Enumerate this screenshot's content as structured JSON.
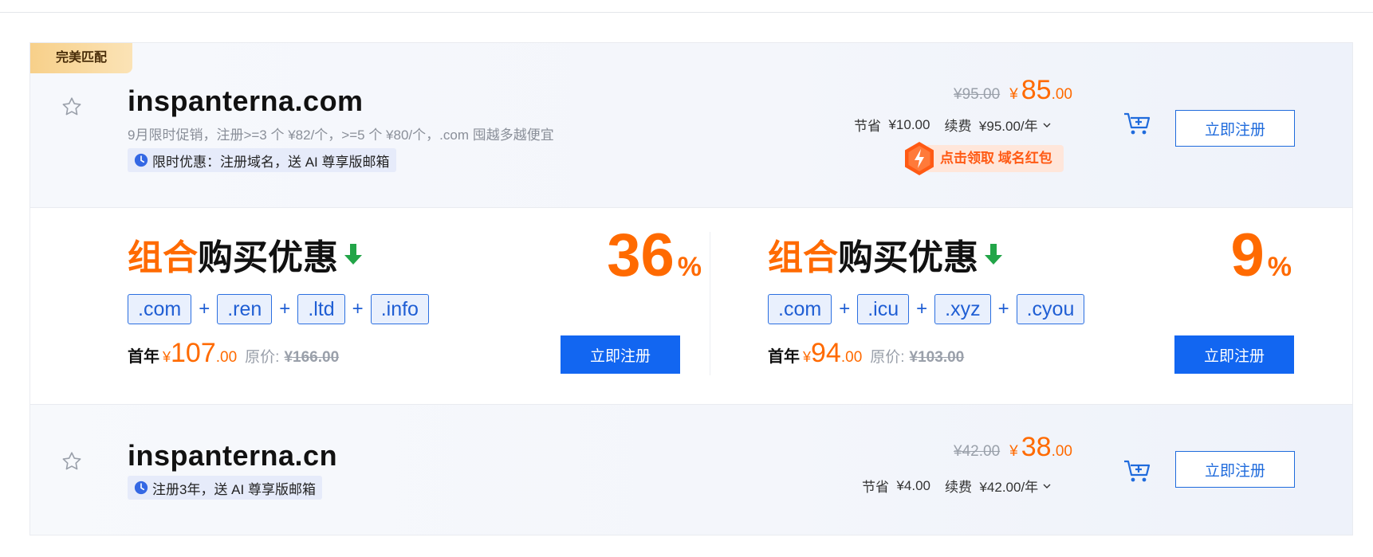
{
  "badge": "完美匹配",
  "results": [
    {
      "domain": "inspanterna.com",
      "promo": "9月限时促销，注册>=3 个 ¥82/个，>=5 个 ¥80/个，.com 囤越多越便宜",
      "tag": "限时优惠：注册域名，送 AI 尊享版邮箱",
      "old_price": "¥95.00",
      "currency": "¥",
      "price_int": "85",
      "price_dec": ".00",
      "save_label": "节省",
      "save_value": "¥10.00",
      "renew_label": "续费",
      "renew_value": "¥95.00/年",
      "coupon": "点击领取 域名红包",
      "register": "立即注册"
    },
    {
      "domain": "inspanterna.cn",
      "tag": "注册3年，送 AI 尊享版邮箱",
      "old_price": "¥42.00",
      "currency": "¥",
      "price_int": "38",
      "price_dec": ".00",
      "save_label": "节省",
      "save_value": "¥4.00",
      "renew_label": "续费",
      "renew_value": "¥42.00/年",
      "register": "立即注册"
    }
  ],
  "combos": [
    {
      "title_orange": "组合",
      "title_black": "购买优惠",
      "discount": "36",
      "pct": "%",
      "suffixes": [
        ".com",
        ".ren",
        ".ltd",
        ".info"
      ],
      "plus": "+",
      "first_year_label": "首年",
      "currency": "¥",
      "price_int": "107",
      "price_dec": ".00",
      "orig_label": "原价:",
      "orig_price": "¥166.00",
      "register": "立即注册"
    },
    {
      "title_orange": "组合",
      "title_black": "购买优惠",
      "discount": "9",
      "pct": "%",
      "suffixes": [
        ".com",
        ".icu",
        ".xyz",
        ".cyou"
      ],
      "plus": "+",
      "first_year_label": "首年",
      "currency": "¥",
      "price_int": "94",
      "price_dec": ".00",
      "orig_label": "原价:",
      "orig_price": "¥103.00",
      "register": "立即注册"
    }
  ],
  "colors": {
    "accent": "#ff6a00",
    "primary": "#1266f1",
    "green_arrow": "#22a548"
  }
}
